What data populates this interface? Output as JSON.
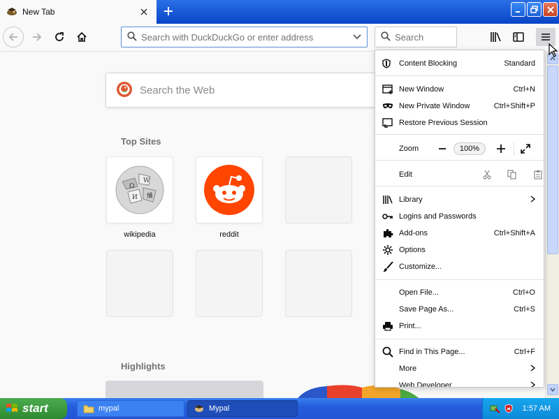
{
  "tab": {
    "title": "New Tab"
  },
  "toolbar": {
    "url_placeholder": "Search with DuckDuckGo or enter address",
    "search_placeholder": "Search"
  },
  "newtab": {
    "search_placeholder": "Search the Web",
    "top_sites_title": "Top Sites",
    "highlights_title": "Highlights",
    "tiles": [
      {
        "label": "wikipedia"
      },
      {
        "label": "reddit"
      }
    ]
  },
  "menu": {
    "content_blocking": {
      "label": "Content Blocking",
      "value": "Standard"
    },
    "new_window": {
      "label": "New Window",
      "shortcut": "Ctrl+N"
    },
    "new_private_window": {
      "label": "New Private Window",
      "shortcut": "Ctrl+Shift+P"
    },
    "restore_session": {
      "label": "Restore Previous Session"
    },
    "zoom": {
      "label": "Zoom",
      "value": "100%"
    },
    "edit": {
      "label": "Edit"
    },
    "library": {
      "label": "Library"
    },
    "logins": {
      "label": "Logins and Passwords"
    },
    "addons": {
      "label": "Add-ons",
      "shortcut": "Ctrl+Shift+A"
    },
    "options": {
      "label": "Options"
    },
    "customize": {
      "label": "Customize..."
    },
    "open_file": {
      "label": "Open File...",
      "shortcut": "Ctrl+O"
    },
    "save_page": {
      "label": "Save Page As...",
      "shortcut": "Ctrl+S"
    },
    "print": {
      "label": "Print..."
    },
    "find": {
      "label": "Find in This Page...",
      "shortcut": "Ctrl+F"
    },
    "more": {
      "label": "More"
    },
    "web_developer": {
      "label": "Web Developer"
    }
  },
  "taskbar": {
    "start_label": "start",
    "tasks": [
      {
        "label": "mypal"
      },
      {
        "label": "Mypal"
      }
    ],
    "clock": "1:57 AM"
  },
  "colors": {
    "reddit": "#ff4500",
    "duckduckgo": "#de5833",
    "xp_blue": "#245ddb",
    "start_green": "#3c9a3e"
  }
}
